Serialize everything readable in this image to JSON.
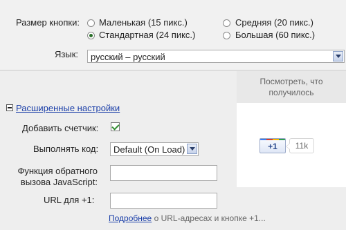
{
  "button_size": {
    "label": "Размер кнопки:",
    "options": [
      {
        "label": "Маленькая (15 пикс.)",
        "checked": false
      },
      {
        "label": "Стандартная (24 пикс.)",
        "checked": true
      },
      {
        "label": "Средняя (20 пикс.)",
        "checked": false
      },
      {
        "label": "Большая (60 пикс.)",
        "checked": false
      }
    ]
  },
  "language": {
    "label": "Язык:",
    "selected": "русский – русский"
  },
  "preview": {
    "header": "Посмотреть, что получилось",
    "plusone_label": "+1",
    "count": "11k"
  },
  "advanced": {
    "toggle_label": "Расширенные настройки",
    "add_counter_label": "Добавить счетчик:",
    "add_counter_checked": true,
    "run_code_label": "Выполнять код:",
    "run_code_selected": "Default (On Load)",
    "callback_label": "Функция обратного вызова JavaScript:",
    "callback_value": "",
    "url_label": "URL для +1:",
    "url_value": ""
  },
  "footer": {
    "link": "Подробнее",
    "text": "о URL-адресах и кнопке +1..."
  },
  "colors": {
    "link": "#1a3ea8",
    "checkmark": "#2f8c2f",
    "background": "#eeeeee"
  }
}
